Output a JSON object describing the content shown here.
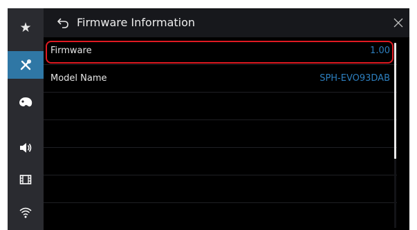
{
  "header": {
    "title": "Firmware Information",
    "back_icon": "back-arrow-icon",
    "close_icon": "close-icon"
  },
  "sidebar": {
    "items": [
      {
        "name": "favorites",
        "icon": "star-icon",
        "glyph": "★",
        "active": false
      },
      {
        "name": "settings",
        "icon": "tools-icon",
        "active": true
      },
      {
        "name": "theme",
        "icon": "palette-icon",
        "active": false
      },
      {
        "name": "audio",
        "icon": "speaker-icon",
        "active": false
      },
      {
        "name": "video",
        "icon": "film-icon",
        "active": false
      },
      {
        "name": "wireless",
        "icon": "wifi-icon",
        "active": false
      }
    ]
  },
  "list": {
    "rows": [
      {
        "label": "Firmware",
        "value": "1.00"
      },
      {
        "label": "Model Name",
        "value": "SPH-EVO93DAB"
      },
      {
        "label": "",
        "value": ""
      },
      {
        "label": "",
        "value": ""
      },
      {
        "label": "",
        "value": ""
      },
      {
        "label": "",
        "value": ""
      },
      {
        "label": "",
        "value": ""
      }
    ]
  },
  "scrollbar": {
    "position": 0.0,
    "visible_fraction": 0.63
  },
  "colors": {
    "accent": "#2f77a5",
    "value_text": "#2d7fbf",
    "highlight": "#e01a22",
    "background": "#000000"
  }
}
